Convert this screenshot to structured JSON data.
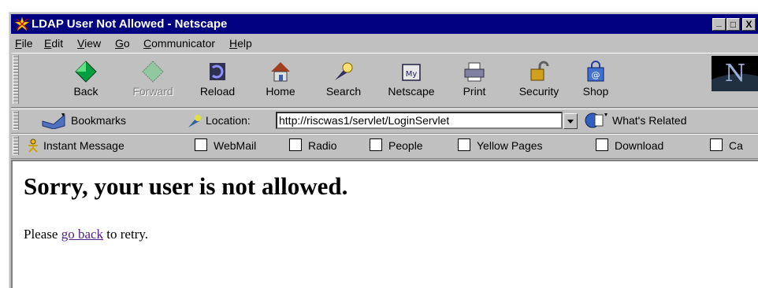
{
  "window": {
    "title": "LDAP User Not Allowed - Netscape",
    "controls": [
      "_",
      "□",
      "X"
    ]
  },
  "menu": [
    {
      "label": "File",
      "key": "F",
      "rest": "ile"
    },
    {
      "label": "Edit",
      "key": "E",
      "rest": "dit"
    },
    {
      "label": "View",
      "key": "V",
      "rest": "iew"
    },
    {
      "label": "Go",
      "key": "G",
      "rest": "o"
    },
    {
      "label": "Communicator",
      "key": "C",
      "rest": "ommunicator"
    },
    {
      "label": "Help",
      "key": "H",
      "rest": "elp"
    }
  ],
  "toolbar": {
    "back": "Back",
    "forward": "Forward",
    "reload": "Reload",
    "home": "Home",
    "search": "Search",
    "netscape": "Netscape",
    "print": "Print",
    "security": "Security",
    "shop": "Shop"
  },
  "location": {
    "bookmarks": "Bookmarks",
    "label": "Location:",
    "url": "http://riscwas1/servlet/LoginServlet",
    "whats_related": "What's Related"
  },
  "personal": {
    "instant_message": "Instant Message",
    "items": [
      "WebMail",
      "Radio",
      "People",
      "Yellow Pages",
      "Download",
      "Ca"
    ]
  },
  "page": {
    "heading": "Sorry, your user is not allowed.",
    "text_before": "Please ",
    "link": "go back",
    "text_after": " to retry."
  },
  "icons": {
    "back": "green-arrow-left-icon",
    "forward": "arrow-right-icon",
    "reload": "reload-icon",
    "home": "home-icon",
    "search": "search-flashlight-icon",
    "netscape": "my-netscape-icon",
    "print": "printer-icon",
    "security": "padlock-icon",
    "shop": "shopping-bag-icon",
    "link": "bookmark-link-icon"
  },
  "colors": {
    "titlebar": "#000080",
    "chrome": "#c0c0c0",
    "visited_link": "#551a8b"
  }
}
